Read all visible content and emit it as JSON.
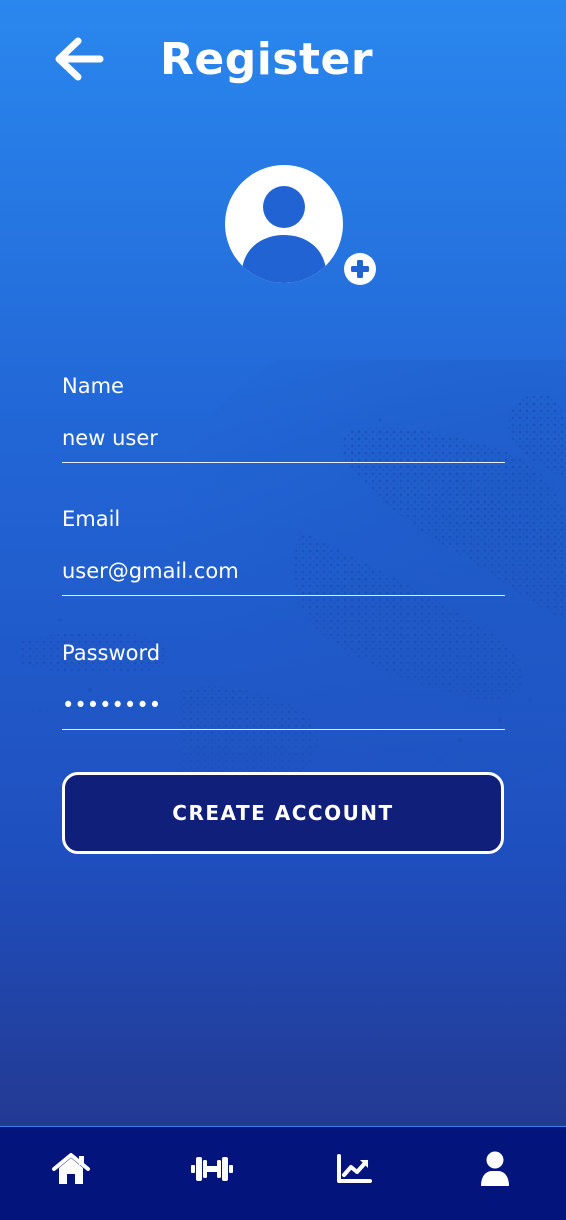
{
  "header": {
    "title": "Register",
    "back_icon": "arrow-left-icon"
  },
  "avatar": {
    "icon": "user-circle-icon",
    "add_icon": "plus-circle-icon"
  },
  "form": {
    "name": {
      "label": "Name",
      "value": "new user"
    },
    "email": {
      "label": "Email",
      "value": "user@gmail.com"
    },
    "password": {
      "label": "Password",
      "value": "••••••••"
    },
    "submit_label": "CREATE ACCOUNT"
  },
  "bottom_nav": {
    "items": [
      {
        "icon": "home-icon"
      },
      {
        "icon": "dumbbell-icon"
      },
      {
        "icon": "chart-line-icon"
      },
      {
        "icon": "user-icon",
        "active": true
      }
    ]
  },
  "colors": {
    "background_top": "#2a87ee",
    "background_bottom": "#233a93",
    "button_fill": "#0f1f7a",
    "nav_background": "#03157d",
    "text": "#ffffff"
  }
}
